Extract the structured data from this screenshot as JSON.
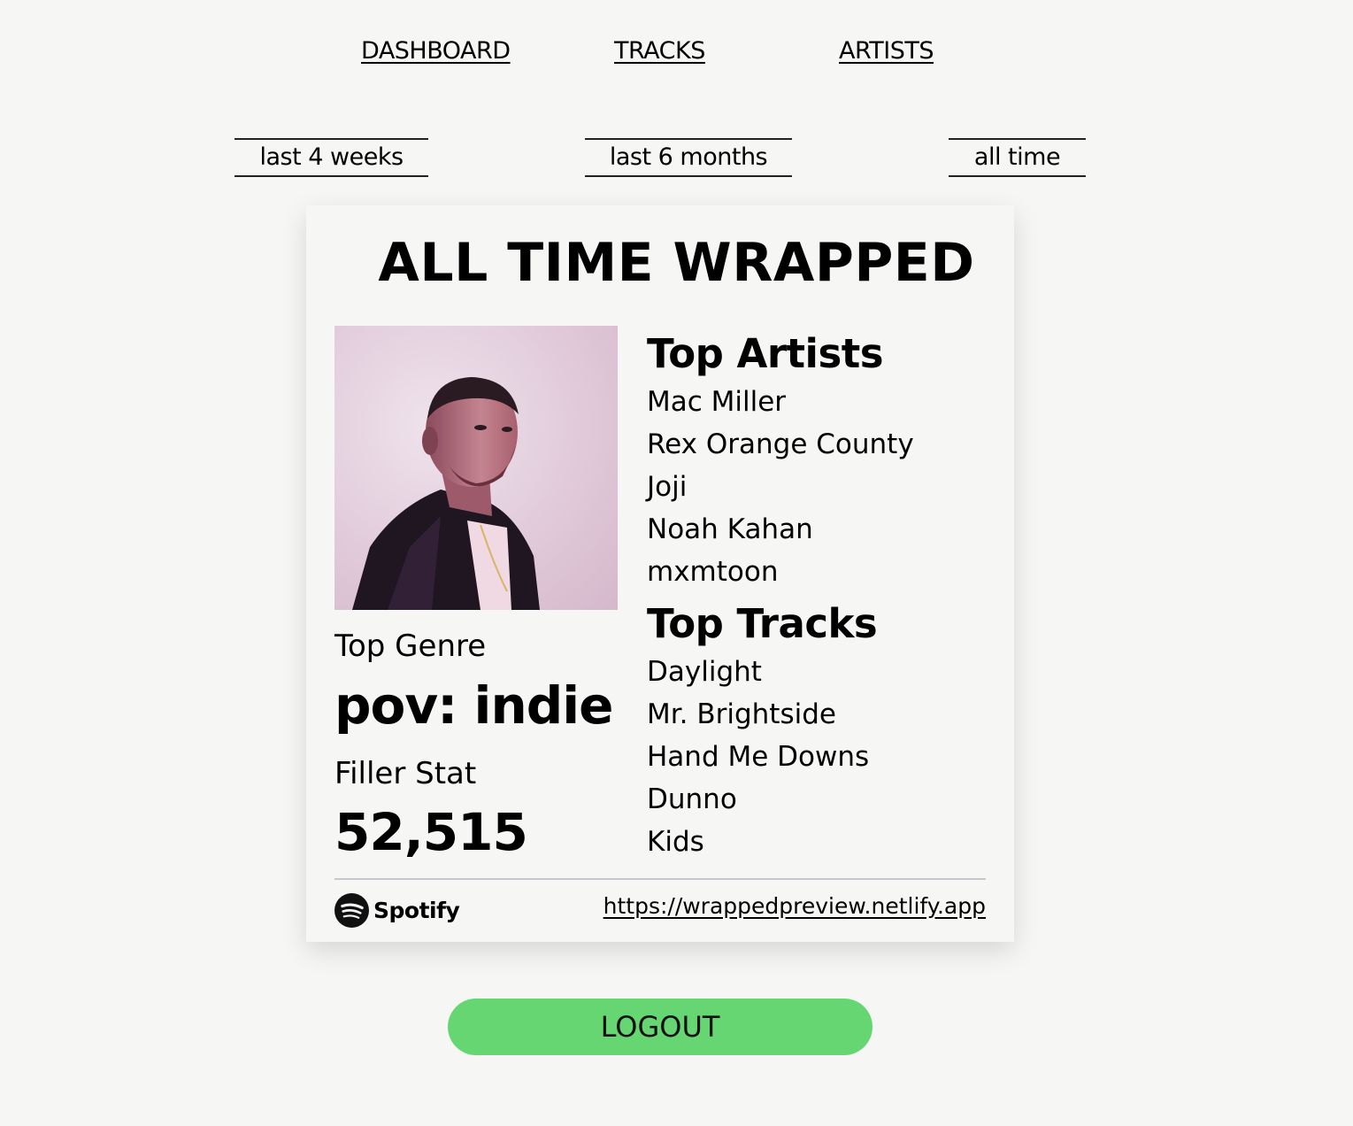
{
  "nav": {
    "items": [
      {
        "label": "DASHBOARD"
      },
      {
        "label": "TRACKS"
      },
      {
        "label": "ARTISTS"
      }
    ]
  },
  "time_ranges": [
    {
      "label": "last 4 weeks"
    },
    {
      "label": "last 6 months"
    },
    {
      "label": "all time"
    }
  ],
  "card": {
    "title": "ALL TIME WRAPPED",
    "top_genre_label": "Top Genre",
    "top_genre": "pov: indie",
    "filler_stat_label": "Filler Stat",
    "filler_stat": "52,515",
    "top_artists_heading": "Top Artists",
    "top_artists": [
      "Mac Miller",
      "Rex Orange County",
      "Joji",
      "Noah Kahan",
      "mxmtoon"
    ],
    "top_tracks_heading": "Top Tracks",
    "top_tracks": [
      "Daylight",
      "Mr. Brightside",
      "Hand Me Downs",
      "Dunno",
      "Kids"
    ],
    "footer_brand": "Spotify",
    "footer_url": "https://wrappedpreview.netlify.app"
  },
  "logout_label": "LOGOUT",
  "colors": {
    "background": "#f6f6f4",
    "logout_button": "#66d672",
    "divider": "#c8c8cc"
  }
}
